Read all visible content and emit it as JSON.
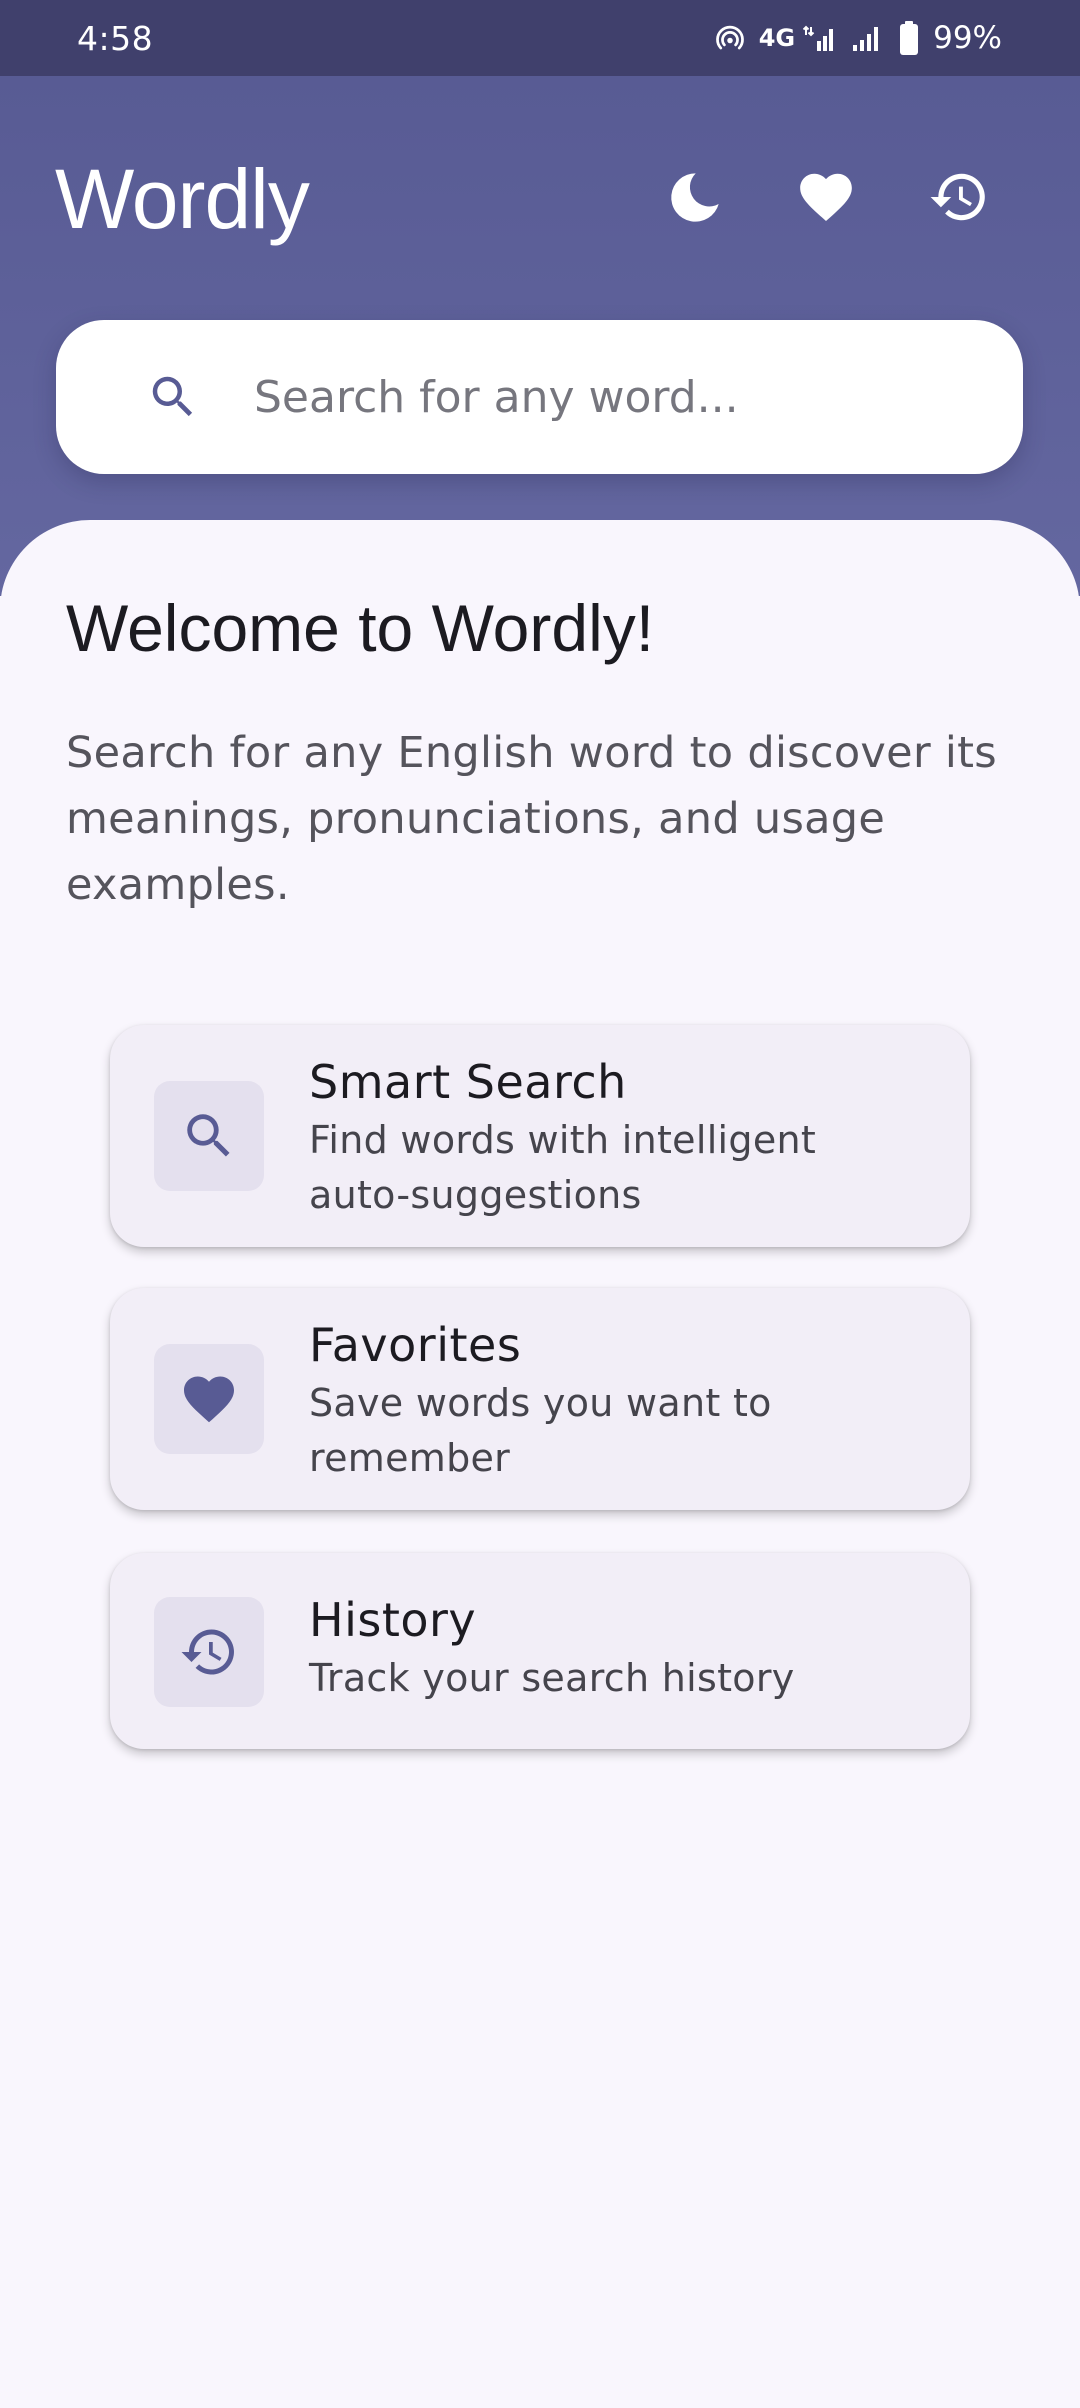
{
  "status_bar": {
    "time": "4:58",
    "network": "4G",
    "battery": "99%"
  },
  "header": {
    "title": "Wordly",
    "icons": [
      "dark-mode-icon",
      "favorites-icon",
      "history-icon"
    ]
  },
  "search": {
    "placeholder": "Search for any word..."
  },
  "welcome": {
    "title": "Welcome to Wordly!",
    "text": "Search for any English word to discover its meanings, pronunciations, and usage examples."
  },
  "features": [
    {
      "title": "Smart Search",
      "description": "Find words with intelligent auto-suggestions",
      "icon": "search-icon"
    },
    {
      "title": "Favorites",
      "description": "Save words you want to remember",
      "icon": "heart-icon"
    },
    {
      "title": "History",
      "description": "Track your search history",
      "icon": "history-icon"
    }
  ],
  "colors": {
    "primary": "#585b94",
    "status_bar": "#40406c",
    "background": "#f9f6fd",
    "card": "#f2eef7",
    "icon_box": "#e4e0ee"
  }
}
